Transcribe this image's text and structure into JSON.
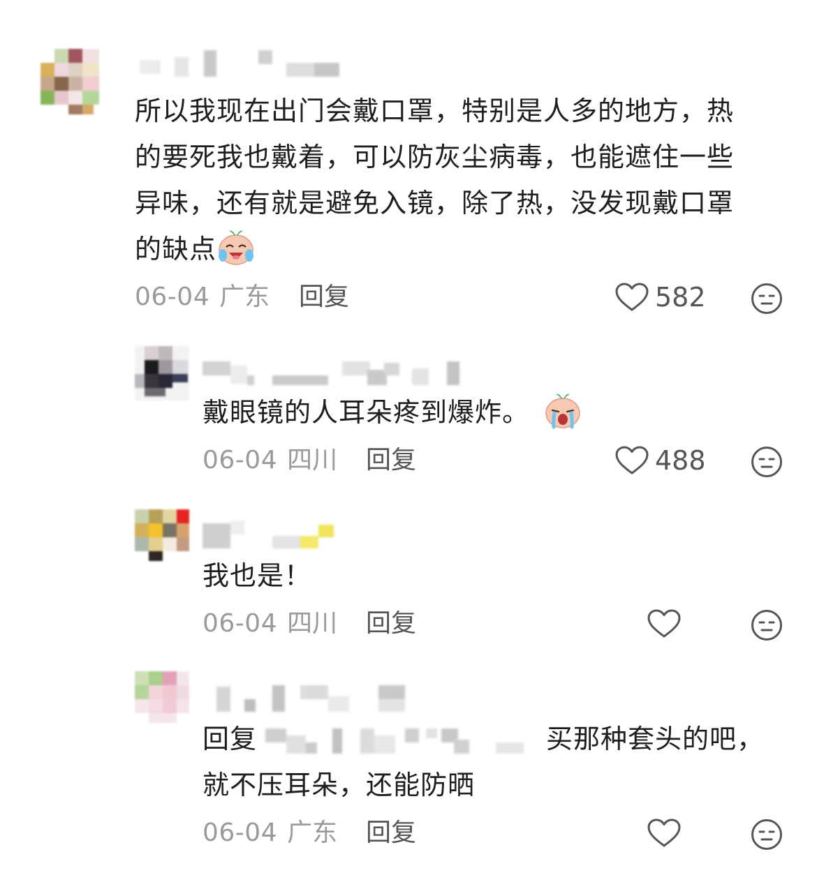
{
  "comments": [
    {
      "text_lines": [
        "所以我现在出门会戴口罩，特别是人多的地方，热",
        "的要死我也戴着，可以防灰尘病毒，也能遮住一些",
        "异味，还有就是避免入镜，除了热，没发现戴口罩",
        "的缺点"
      ],
      "date": "06-04",
      "location": "广东",
      "reply_label": "回复",
      "likes": "582",
      "emoji": "crying-laughing-face-emoji"
    },
    {
      "text": "戴眼镜的人耳朵疼到爆炸。",
      "date": "06-04",
      "location": "四川",
      "reply_label": "回复",
      "likes": "488",
      "emoji": "crying-face-emoji"
    },
    {
      "text": "我也是！",
      "date": "06-04",
      "location": "四川",
      "reply_label": "回复",
      "likes": ""
    },
    {
      "reply_prefix": "回复",
      "text_line1": "买那种套头的吧，",
      "text_line2": "就不压耳朵，还能防晒",
      "date": "06-04",
      "location": "广东",
      "reply_label": "回复",
      "likes": ""
    }
  ],
  "colors": {
    "text": "#1e1e1e",
    "meta": "#9a9a9a",
    "action": "#555555"
  },
  "icons": {
    "like": "heart-outline-icon",
    "dislike": "neutral-face-icon"
  }
}
